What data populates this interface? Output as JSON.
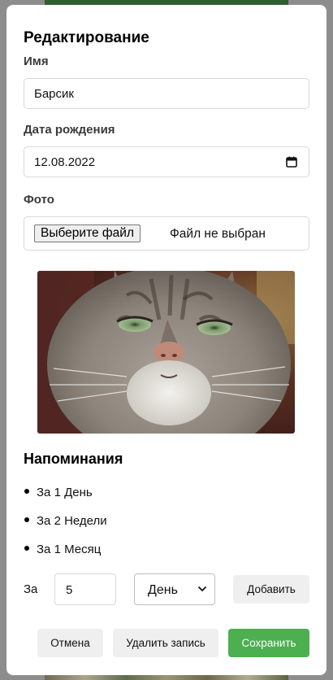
{
  "modal": {
    "title": "Редактирование",
    "name": {
      "label": "Имя",
      "value": "Барсик"
    },
    "birthdate": {
      "label": "Дата рождения",
      "value": "12.08.2022"
    },
    "photo": {
      "label": "Фото",
      "choose_button": "Выберите файл",
      "status": "Файл не выбран"
    },
    "reminders": {
      "heading": "Напоминания",
      "items": [
        "За 1 День",
        "За 2 Недели",
        "За 1 Месяц"
      ],
      "add_row": {
        "prefix": "За",
        "amount": "5",
        "unit": "День",
        "add_button": "Добавить"
      }
    },
    "footer": {
      "cancel": "Отмена",
      "delete": "Удалить запись",
      "save": "Сохранить"
    }
  },
  "colors": {
    "primary": "#4caf50",
    "secondary_button": "#efefef",
    "backdrop": "#8d8d8d"
  },
  "icons": {
    "date_picker": "calendar-icon",
    "select_arrow": "chevron-down-icon"
  }
}
